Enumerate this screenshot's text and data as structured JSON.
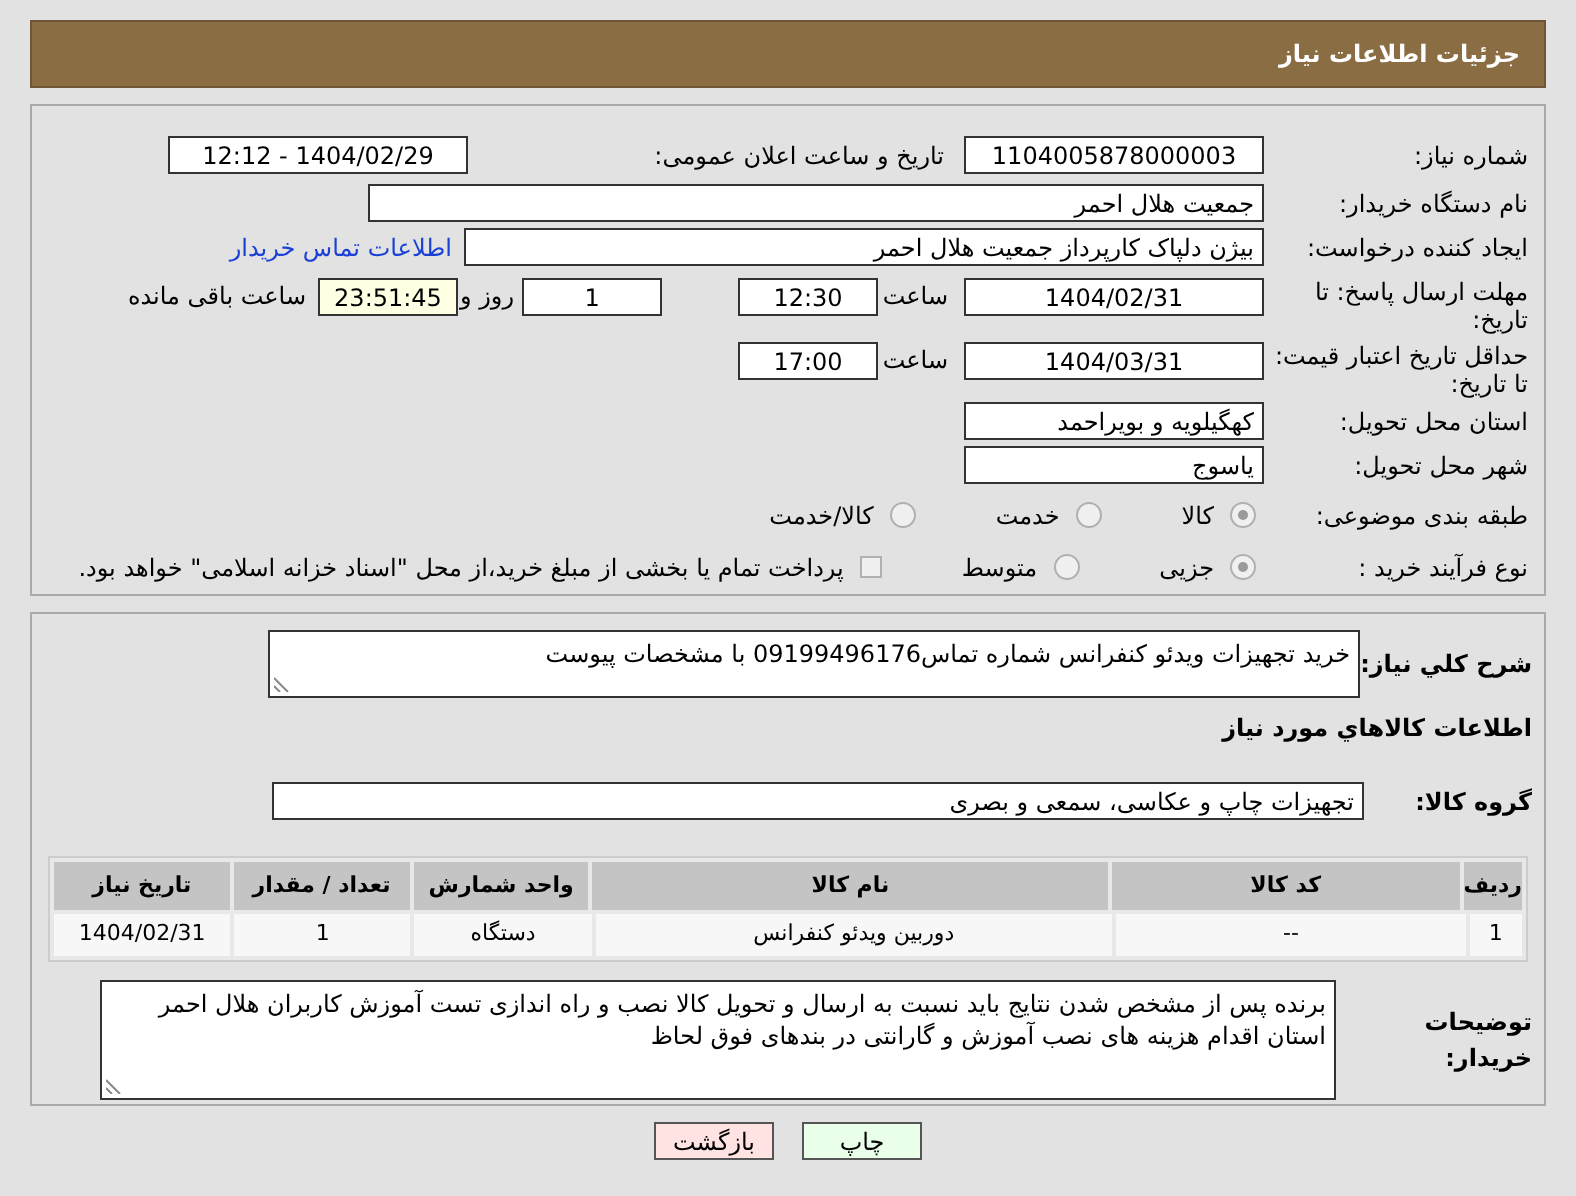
{
  "title": "جزئیات اطلاعات نیاز",
  "need_number": {
    "label": "شماره نیاز:",
    "value": "1104005878000003"
  },
  "announce": {
    "label": "تاریخ و ساعت اعلان عمومی:",
    "value": "1404/02/29 - 12:12"
  },
  "buyer": {
    "label": "نام دستگاه خریدار:",
    "value": "جمعیت هلال احمر"
  },
  "creator": {
    "label": "ایجاد کننده درخواست:",
    "value": "بیژن دلپاک کارپرداز جمعیت هلال احمر",
    "link": "اطلاعات تماس خریدار"
  },
  "deadline": {
    "label": "مهلت ارسال پاسخ: تا تاریخ:",
    "date": "1404/02/31",
    "time_label": "ساعت",
    "time": "12:30",
    "days": "1",
    "days_label": "روز و",
    "remaining": "23:51:45",
    "remaining_label": "ساعت باقی مانده"
  },
  "validity": {
    "label": "حداقل تاریخ اعتبار قیمت: تا تاریخ:",
    "date": "1404/03/31",
    "time_label": "ساعت",
    "time": "17:00"
  },
  "province": {
    "label": "استان محل تحویل:",
    "value": "کهگیلویه و بویراحمد"
  },
  "city": {
    "label": "شهر محل تحویل:",
    "value": "یاسوج"
  },
  "category": {
    "label": "طبقه بندی موضوعی:",
    "options": [
      {
        "label": "کالا",
        "selected": true
      },
      {
        "label": "خدمت",
        "selected": false
      },
      {
        "label": "کالا/خدمت",
        "selected": false
      }
    ]
  },
  "process": {
    "label": "نوع فرآیند خرید :",
    "options": [
      {
        "label": "جزیی",
        "selected": true
      },
      {
        "label": "متوسط",
        "selected": false
      }
    ],
    "payment": {
      "label": "پرداخت تمام یا بخشی از مبلغ خرید،از محل \"اسناد خزانه اسلامی\" خواهد بود.",
      "checked": false
    }
  },
  "description": {
    "label": "شرح كلي نیاز:",
    "value": "خرید تجهیزات ویدئو کنفرانس شماره تماس09199496176 با مشخصات پیوست"
  },
  "goods_title": "اطلاعات کالاهاي مورد نیاز",
  "group": {
    "label": "گروه کالا:",
    "value": "تجهیزات چاپ و عکاسی، سمعی و بصری"
  },
  "table": {
    "columns": [
      "ردیف",
      "کد کالا",
      "نام کالا",
      "واحد شمارش",
      "تعداد / مقدار",
      "تاریخ نیاز"
    ],
    "rows": [
      [
        "1",
        "--",
        "دوربین ویدئو کنفرانس",
        "دستگاه",
        "1",
        "1404/02/31"
      ]
    ]
  },
  "notes": {
    "label": "توضیحات خریدار:",
    "value": "برنده پس از مشخص شدن نتایج باید نسبت به ارسال و تحویل کالا نصب و راه اندازی تست آموزش کاربران هلال احمر استان اقدام هزینه های نصب آموزش و گارانتی در بندهای فوق لحاظ"
  },
  "buttons": [
    {
      "label": "چاپ",
      "kind": "print"
    },
    {
      "label": "بازگشت",
      "kind": "back"
    }
  ]
}
